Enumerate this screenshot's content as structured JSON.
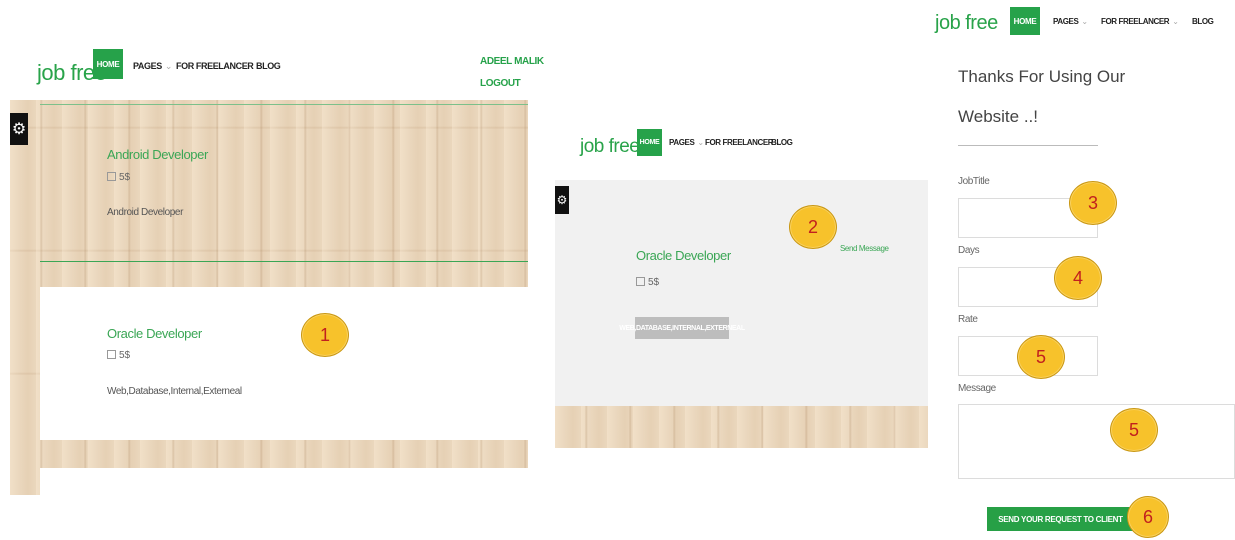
{
  "nav": {
    "logo": "job free",
    "home": "HOME",
    "pages": "PAGES",
    "freelancer": "FOR FREELANCER",
    "blog": "BLOG",
    "caret": "⌄"
  },
  "user": {
    "name": "ADEEL MALIK",
    "logout": "LOGOUT"
  },
  "panel1": {
    "jobs": [
      {
        "title": "Android Developer",
        "rate": "5$",
        "description": "Android Developer"
      },
      {
        "title": "Oracle Developer",
        "rate": "5$",
        "description": "Web,Database,Internal,Externeal"
      }
    ]
  },
  "panel2": {
    "job": {
      "title": "Oracle Developer",
      "rate": "5$",
      "tags": "WEB,DATABASE,INTERNAL,EXTERNEAL"
    },
    "send_message": "Send Message"
  },
  "panel3": {
    "thanks_line1": "Thanks For Using Our",
    "thanks_line2": "Website ..!",
    "fields": {
      "job_title_label": "JobTitle",
      "days_label": "Days",
      "rate_label": "Rate",
      "message_label": "Message"
    },
    "submit": "SEND YOUR REQUEST TO CLIENT"
  },
  "callouts": [
    "1",
    "2",
    "3",
    "4",
    "5",
    "5",
    "6"
  ],
  "colors": {
    "brand_green": "#26a24a",
    "badge_yellow": "#f7c22b",
    "badge_text": "#c2201e"
  },
  "icons": {
    "settings": "gear-icon"
  }
}
